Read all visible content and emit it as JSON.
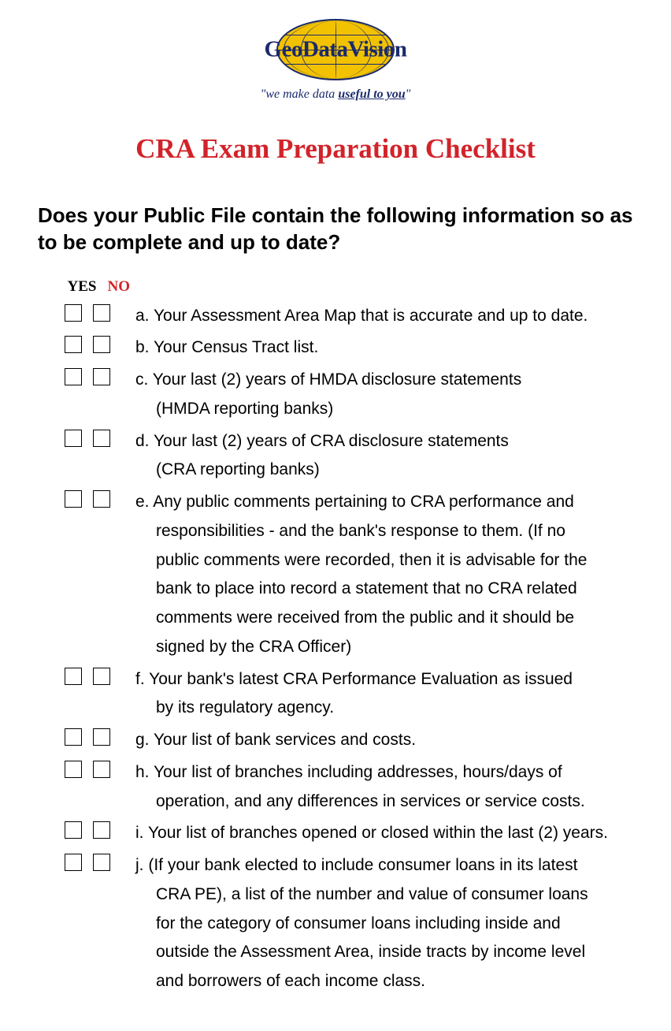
{
  "logo": {
    "text": "GeoDataVision",
    "tagline_prefix": "\"we make data ",
    "tagline_underline": "useful to you",
    "tagline_suffix": "\""
  },
  "title": "CRA Exam Preparation Checklist",
  "question": "Does your Public File contain the following information so as to be complete and up to date?",
  "headers": {
    "yes": "YES",
    "no": "NO"
  },
  "items": [
    {
      "lines": [
        "a. Your Assessment Area Map that is accurate and up to date."
      ]
    },
    {
      "lines": [
        "b. Your Census Tract list."
      ]
    },
    {
      "lines": [
        "c. Your last (2) years of HMDA disclosure statements",
        "(HMDA reporting banks)"
      ]
    },
    {
      "lines": [
        "d. Your last (2) years of CRA disclosure statements",
        "(CRA reporting banks)"
      ]
    },
    {
      "lines": [
        "e. Any public comments pertaining to CRA performance and",
        "responsibilities - and the bank's response to them.  (If no",
        "public comments were recorded, then it is advisable for the",
        "bank to place into record a statement that no CRA related",
        "comments were received from the public and it should be",
        "signed by the CRA Officer)"
      ]
    },
    {
      "lines": [
        "f. Your bank's latest CRA Performance Evaluation as issued",
        "by its regulatory agency."
      ]
    },
    {
      "lines": [
        "g. Your list of bank services and costs."
      ]
    },
    {
      "lines": [
        "h. Your list of branches including addresses, hours/days of",
        "operation, and any differences in services or service costs."
      ]
    },
    {
      "lines": [
        "i. Your list of branches opened or closed within the last (2) years."
      ]
    },
    {
      "lines": [
        "j. (If  your bank elected to include consumer loans in its latest",
        "CRA PE), a list of the number and value of consumer loans",
        "for the category of consumer loans including inside and",
        "outside the Assessment Area, inside tracts by income level",
        "and borrowers of each income class."
      ]
    }
  ]
}
